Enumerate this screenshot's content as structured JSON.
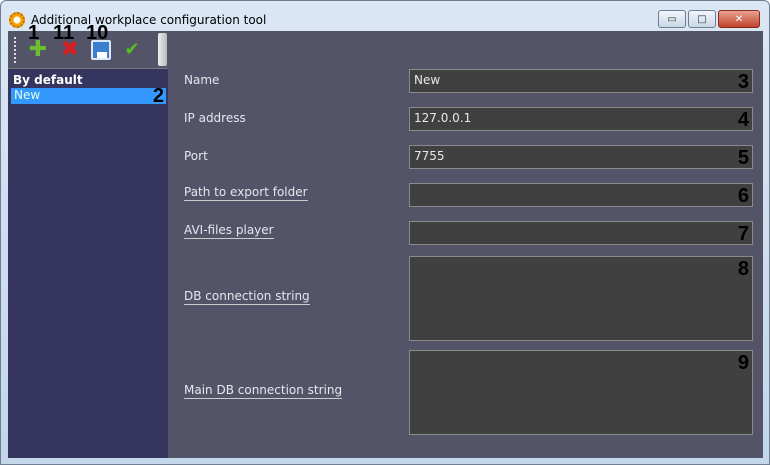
{
  "window": {
    "title": "Additional workplace configuration tool",
    "minimize": "▭",
    "maximize": "□",
    "close": "✕"
  },
  "toolbar": {
    "add_icon": "plus-icon",
    "delete_icon": "x-icon",
    "save_icon": "floppy-icon",
    "apply_icon": "check-icon",
    "add_glyph": "✚",
    "delete_glyph": "✖",
    "apply_glyph": "✔"
  },
  "callouts": {
    "add": "1",
    "delete": "11",
    "save": "10",
    "item": "2",
    "name": "3",
    "ip": "4",
    "port": "5",
    "export": "6",
    "avi": "7",
    "db": "8",
    "maindb": "9"
  },
  "sidebar": {
    "group": "By default",
    "items": [
      {
        "label": "New",
        "selected": true
      }
    ]
  },
  "form": {
    "name": {
      "label": "Name",
      "value": "New"
    },
    "ip": {
      "label": "IP address",
      "value": "127.0.0.1"
    },
    "port": {
      "label": "Port",
      "value": "7755"
    },
    "export": {
      "label": "Path to export folder",
      "value": ""
    },
    "avi": {
      "label": "AVI-files player",
      "value": ""
    },
    "db": {
      "label": "DB connection string",
      "value": ""
    },
    "maindb": {
      "label": "Main DB connection string",
      "value": ""
    }
  },
  "colors": {
    "background": "#545468",
    "sidebar": "#35355f",
    "selection": "#3399ff",
    "field": "#404040"
  }
}
